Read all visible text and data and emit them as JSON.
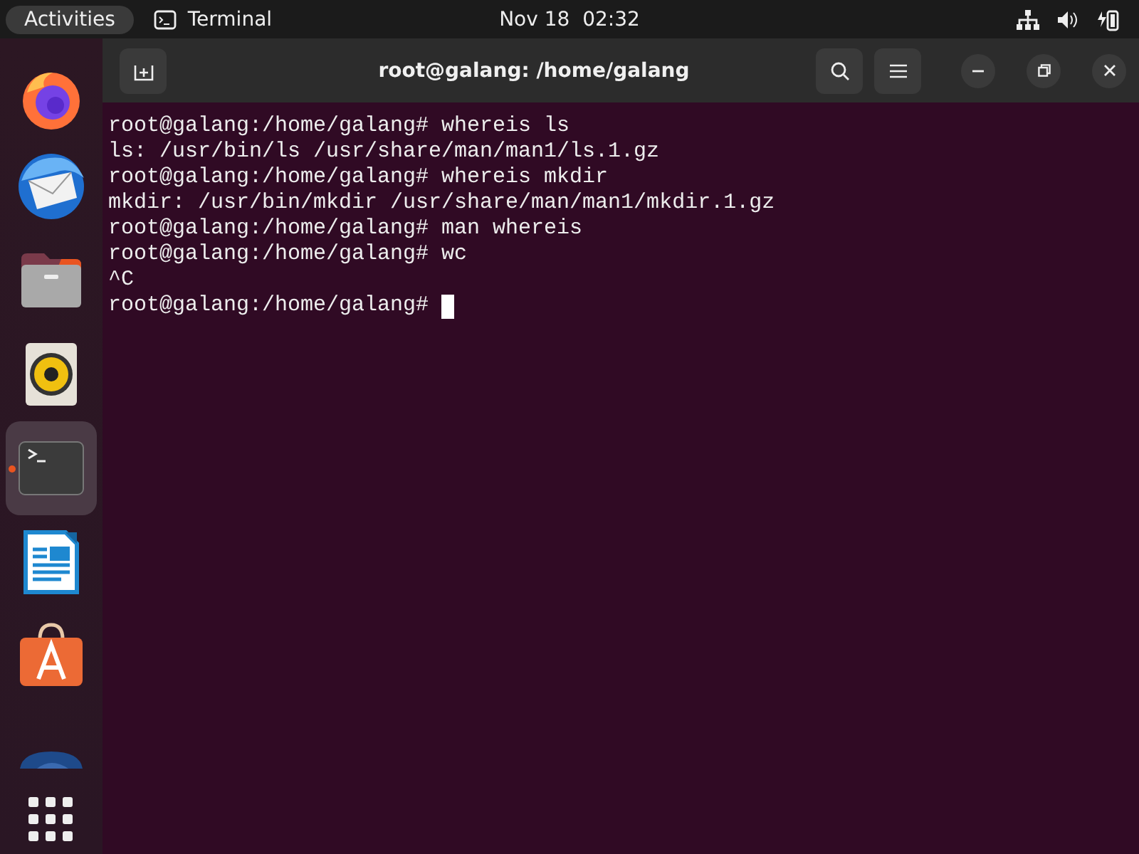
{
  "top_bar": {
    "activities": "Activities",
    "app_name": "Terminal",
    "clock": "Nov 18  02:32"
  },
  "dock": [
    {
      "kind": "firefox",
      "selected": false,
      "running": false
    },
    {
      "kind": "mail",
      "selected": false,
      "running": false
    },
    {
      "kind": "files",
      "selected": false,
      "running": false
    },
    {
      "kind": "speaker",
      "selected": false,
      "running": false
    },
    {
      "kind": "terminal",
      "selected": true,
      "running": true
    },
    {
      "kind": "writer",
      "selected": false,
      "running": false
    },
    {
      "kind": "store",
      "selected": false,
      "running": false
    },
    {
      "kind": "partial",
      "selected": false,
      "running": false
    },
    {
      "kind": "grid",
      "selected": false,
      "running": false
    }
  ],
  "window": {
    "title": "root@galang: /home/galang"
  },
  "terminal": {
    "lines": [
      "root@galang:/home/galang# whereis ls",
      "ls: /usr/bin/ls /usr/share/man/man1/ls.1.gz",
      "root@galang:/home/galang# whereis mkdir",
      "mkdir: /usr/bin/mkdir /usr/share/man/man1/mkdir.1.gz",
      "root@galang:/home/galang# man whereis",
      "root@galang:/home/galang# wc",
      "^C",
      "root@galang:/home/galang# "
    ],
    "cursor": true
  }
}
